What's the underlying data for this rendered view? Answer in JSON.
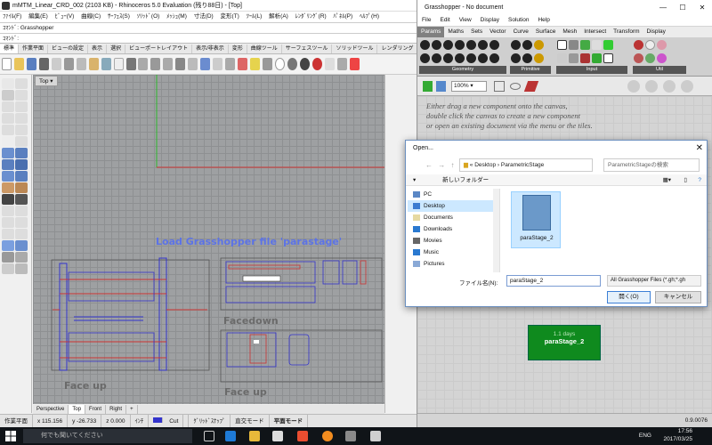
{
  "rhino": {
    "title": "mMTM_Linear_CRD_002 (2103 KB) - Rhinoceros 5.0 Evaluation (残り88日) - [Top]",
    "menu": [
      "ﾌｧｲﾙ(F)",
      "編集(E)",
      "ﾋﾞｭｰ(V)",
      "曲線(C)",
      "ｻｰﾌｪｽ(S)",
      "ｿﾘｯﾄﾞ(O)",
      "ﾒｯｼｭ(M)",
      "寸法(D)",
      "変形(T)",
      "ﾂｰﾙ(L)",
      "解析(A)",
      "ﾚﾝﾀﾞﾘﾝｸﾞ(R)",
      "ﾊﾟﾈﾙ(P)",
      "ﾍﾙﾌﾟ(H)"
    ],
    "command_history": "ｺﾏﾝﾄﾞ: Grasshopper",
    "command_prompt": "ｺﾏﾝﾄﾞ:",
    "toolbar_tabs": [
      "標準",
      "作業平面",
      "ビューの設定",
      "表示",
      "選択",
      "ビューポートレイアウト",
      "表示/非表示",
      "変形",
      "曲線ツール",
      "サーフェスツール",
      "ソリッドツール",
      "レンダリング"
    ],
    "active_tab": "標準",
    "viewport": {
      "label": "Top",
      "annotation_load": "Load Grasshopper file 'parastage'",
      "annotation_facedown": "Facedown",
      "annotation_faceup_left": "Face up",
      "annotation_faceup_right": "Face up"
    },
    "viewport_tabs": [
      "Perspective",
      "Top",
      "Front",
      "Right",
      "+"
    ],
    "active_viewport_tab": "Top",
    "status": {
      "cplane": "作業平面",
      "x": "x 115.156",
      "y": "y -26.733",
      "z": "z 0.000",
      "unit": "ｲﾝﾁ",
      "layer": "Cut",
      "grid_snap": "ｸﾞﾘｯﾄﾞｽﾅｯﾌﾟ",
      "ortho": "直交モード",
      "planar": "平面モード"
    }
  },
  "grasshopper": {
    "title": "Grasshopper - No document",
    "menu": [
      "File",
      "Edit",
      "View",
      "Display",
      "Solution",
      "Help"
    ],
    "tabs": [
      "Params",
      "Maths",
      "Sets",
      "Vector",
      "Curve",
      "Surface",
      "Mesh",
      "Intersect",
      "Transform",
      "Display"
    ],
    "active_tab": "Params",
    "ribbon_groups": [
      "Geometry",
      "Primitive",
      "Input",
      "Util"
    ],
    "zoom": "100%",
    "canvas_hint": [
      "Either drag a new component onto the canvas,",
      "double click the canvas to create a new component",
      "or open an existing document via the menu or the tiles."
    ],
    "tile": {
      "age": "1.1 days",
      "name": "paraStage_2"
    },
    "version": "0.9.0076"
  },
  "open_dialog": {
    "title": "Open...",
    "path": [
      "Desktop",
      "ParametricStage"
    ],
    "search_placeholder": "ParametricStageの検索",
    "new_folder": "新しいフォルダー",
    "tree": [
      "PC",
      "Desktop",
      "Documents",
      "Downloads",
      "Movies",
      "Music",
      "Pictures"
    ],
    "selected_tree_item": "Desktop",
    "file": "paraStage_2",
    "filename_label": "ファイル名(N):",
    "filename_value": "paraStage_2",
    "filetype": "All Grasshopper Files (*.gh;*.gh",
    "open_button": "開く(O)",
    "cancel_button": "キャンセル"
  },
  "taskbar": {
    "search_placeholder": "何でも聞いてください",
    "lang": "ENG",
    "time": "17:56",
    "date": "2017/03/25"
  }
}
